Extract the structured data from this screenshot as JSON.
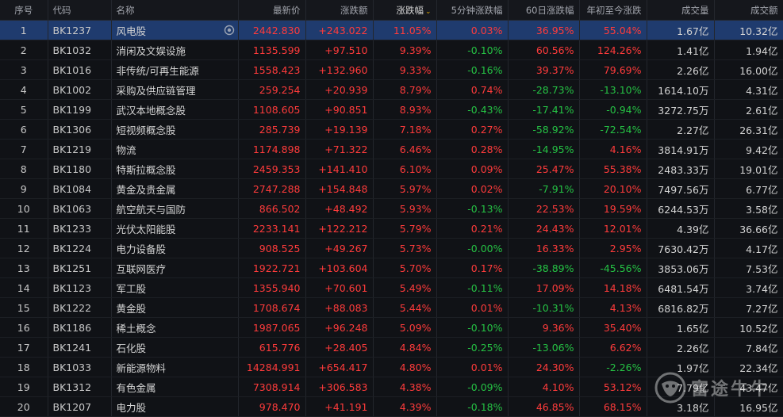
{
  "header": {
    "columns": [
      "序号",
      "代码",
      "名称",
      "最新价",
      "涨跌额",
      "涨跌幅",
      "5分钟涨跌幅",
      "60日涨跌幅",
      "年初至今涨跌",
      "成交量",
      "成交额"
    ],
    "sorted_column": "涨跌幅",
    "sort_direction": "desc"
  },
  "colors": {
    "up": "#ff3b3b",
    "down": "#25c244",
    "selected_row": "#1f3b6e"
  },
  "selected_row": 0,
  "rows": [
    {
      "idx": "1",
      "code": "BK1237",
      "name": "风电股",
      "price": "2442.830",
      "chg": "+243.022",
      "pct": "11.05%",
      "m5": "0.03%",
      "d60": "36.95%",
      "ytd": "55.04%",
      "vol": "1.67亿",
      "amt": "10.32亿"
    },
    {
      "idx": "2",
      "code": "BK1032",
      "name": "消闲及文娱设施",
      "price": "1135.599",
      "chg": "+97.510",
      "pct": "9.39%",
      "m5": "-0.10%",
      "d60": "60.56%",
      "ytd": "124.26%",
      "vol": "1.41亿",
      "amt": "1.94亿"
    },
    {
      "idx": "3",
      "code": "BK1016",
      "name": "非传统/可再生能源",
      "price": "1558.423",
      "chg": "+132.960",
      "pct": "9.33%",
      "m5": "-0.16%",
      "d60": "39.37%",
      "ytd": "79.69%",
      "vol": "2.26亿",
      "amt": "16.00亿"
    },
    {
      "idx": "4",
      "code": "BK1002",
      "name": "采购及供应链管理",
      "price": "259.254",
      "chg": "+20.939",
      "pct": "8.79%",
      "m5": "0.74%",
      "d60": "-28.73%",
      "ytd": "-13.10%",
      "vol": "1614.10万",
      "amt": "4.31亿"
    },
    {
      "idx": "5",
      "code": "BK1199",
      "name": "武汉本地概念股",
      "price": "1108.605",
      "chg": "+90.851",
      "pct": "8.93%",
      "m5": "-0.43%",
      "d60": "-17.41%",
      "ytd": "-0.94%",
      "vol": "3272.75万",
      "amt": "2.61亿"
    },
    {
      "idx": "6",
      "code": "BK1306",
      "name": "短视频概念股",
      "price": "285.739",
      "chg": "+19.139",
      "pct": "7.18%",
      "m5": "0.27%",
      "d60": "-58.92%",
      "ytd": "-72.54%",
      "vol": "2.27亿",
      "amt": "26.31亿"
    },
    {
      "idx": "7",
      "code": "BK1219",
      "name": "物流",
      "price": "1174.898",
      "chg": "+71.322",
      "pct": "6.46%",
      "m5": "0.28%",
      "d60": "-14.95%",
      "ytd": "4.16%",
      "vol": "3814.91万",
      "amt": "9.42亿"
    },
    {
      "idx": "8",
      "code": "BK1180",
      "name": "特斯拉概念股",
      "price": "2459.353",
      "chg": "+141.410",
      "pct": "6.10%",
      "m5": "0.09%",
      "d60": "25.47%",
      "ytd": "55.38%",
      "vol": "2483.33万",
      "amt": "19.01亿"
    },
    {
      "idx": "9",
      "code": "BK1084",
      "name": "黄金及贵金属",
      "price": "2747.288",
      "chg": "+154.848",
      "pct": "5.97%",
      "m5": "0.02%",
      "d60": "-7.91%",
      "ytd": "20.10%",
      "vol": "7497.56万",
      "amt": "6.77亿"
    },
    {
      "idx": "10",
      "code": "BK1063",
      "name": "航空航天与国防",
      "price": "866.502",
      "chg": "+48.492",
      "pct": "5.93%",
      "m5": "-0.13%",
      "d60": "22.53%",
      "ytd": "19.59%",
      "vol": "6244.53万",
      "amt": "3.58亿"
    },
    {
      "idx": "11",
      "code": "BK1233",
      "name": "光伏太阳能股",
      "price": "2233.141",
      "chg": "+122.212",
      "pct": "5.79%",
      "m5": "0.21%",
      "d60": "24.43%",
      "ytd": "12.01%",
      "vol": "4.39亿",
      "amt": "36.66亿"
    },
    {
      "idx": "12",
      "code": "BK1224",
      "name": "电力设备股",
      "price": "908.525",
      "chg": "+49.267",
      "pct": "5.73%",
      "m5": "-0.00%",
      "d60": "16.33%",
      "ytd": "2.95%",
      "vol": "7630.42万",
      "amt": "4.17亿"
    },
    {
      "idx": "13",
      "code": "BK1251",
      "name": "互联网医疗",
      "price": "1922.721",
      "chg": "+103.604",
      "pct": "5.70%",
      "m5": "0.17%",
      "d60": "-38.89%",
      "ytd": "-45.56%",
      "vol": "3853.06万",
      "amt": "7.53亿"
    },
    {
      "idx": "14",
      "code": "BK1123",
      "name": "军工股",
      "price": "1355.940",
      "chg": "+70.601",
      "pct": "5.49%",
      "m5": "-0.11%",
      "d60": "17.09%",
      "ytd": "14.18%",
      "vol": "6481.54万",
      "amt": "3.74亿"
    },
    {
      "idx": "15",
      "code": "BK1222",
      "name": "黄金股",
      "price": "1708.674",
      "chg": "+88.083",
      "pct": "5.44%",
      "m5": "0.01%",
      "d60": "-10.31%",
      "ytd": "4.13%",
      "vol": "6816.82万",
      "amt": "7.27亿"
    },
    {
      "idx": "16",
      "code": "BK1186",
      "name": "稀土概念",
      "price": "1987.065",
      "chg": "+96.248",
      "pct": "5.09%",
      "m5": "-0.10%",
      "d60": "9.36%",
      "ytd": "35.40%",
      "vol": "1.65亿",
      "amt": "10.52亿"
    },
    {
      "idx": "17",
      "code": "BK1241",
      "name": "石化股",
      "price": "615.776",
      "chg": "+28.405",
      "pct": "4.84%",
      "m5": "-0.25%",
      "d60": "-13.06%",
      "ytd": "6.62%",
      "vol": "2.26亿",
      "amt": "7.84亿"
    },
    {
      "idx": "18",
      "code": "BK1033",
      "name": "新能源物料",
      "price": "14284.991",
      "chg": "+654.417",
      "pct": "4.80%",
      "m5": "0.01%",
      "d60": "24.30%",
      "ytd": "-2.26%",
      "vol": "1.97亿",
      "amt": "22.34亿"
    },
    {
      "idx": "19",
      "code": "BK1312",
      "name": "有色金属",
      "price": "7308.914",
      "chg": "+306.583",
      "pct": "4.38%",
      "m5": "-0.09%",
      "d60": "4.10%",
      "ytd": "53.12%",
      "vol": "7.79亿",
      "amt": "43.47亿"
    },
    {
      "idx": "20",
      "code": "BK1207",
      "name": "电力股",
      "price": "978.470",
      "chg": "+41.191",
      "pct": "4.39%",
      "m5": "-0.18%",
      "d60": "46.85%",
      "ytd": "68.15%",
      "vol": "3.18亿",
      "amt": "16.95亿"
    }
  ],
  "watermark": {
    "text": "富途牛牛",
    "icon": "futu-bull-logo-icon"
  }
}
